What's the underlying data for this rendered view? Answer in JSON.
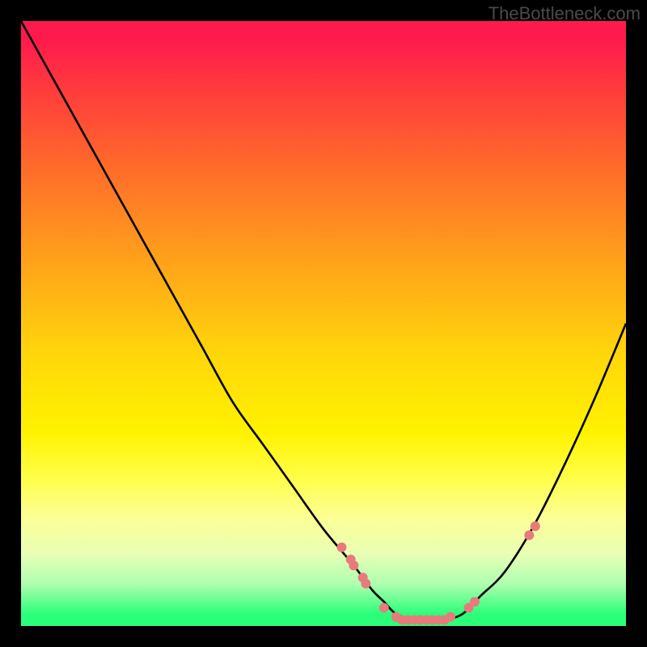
{
  "watermark": "TheBottleneck.com",
  "chart_data": {
    "type": "line",
    "title": "",
    "xlabel": "",
    "ylabel": "",
    "xlim": [
      0,
      100
    ],
    "ylim": [
      0,
      100
    ],
    "grid": false,
    "background_gradient": {
      "stops": [
        {
          "pos": 0,
          "color": "#ff1a4d"
        },
        {
          "pos": 11,
          "color": "#ff3a3d"
        },
        {
          "pos": 24,
          "color": "#ff6a2a"
        },
        {
          "pos": 40,
          "color": "#ffa31a"
        },
        {
          "pos": 55,
          "color": "#ffd60a"
        },
        {
          "pos": 68,
          "color": "#fff200"
        },
        {
          "pos": 82,
          "color": "#fcff94"
        },
        {
          "pos": 93,
          "color": "#b0ffb0"
        },
        {
          "pos": 100,
          "color": "#2bff7a"
        }
      ]
    },
    "series": [
      {
        "name": "bottleneck-curve",
        "color": "#000000",
        "x": [
          0,
          5,
          10,
          15,
          20,
          25,
          30,
          35,
          40,
          45,
          50,
          55,
          58,
          60,
          62,
          65,
          68,
          70,
          73,
          76,
          80,
          85,
          90,
          95,
          100
        ],
        "values": [
          100,
          91,
          82,
          73,
          64,
          55,
          46,
          37,
          30,
          23,
          16,
          10,
          6,
          4,
          2,
          1,
          1,
          1,
          2,
          5,
          9,
          17,
          27,
          38,
          50
        ]
      }
    ],
    "scatter": {
      "name": "highlighted-points",
      "color": "#e77b7b",
      "radius": 6,
      "points": [
        {
          "x": 53,
          "y": 13
        },
        {
          "x": 54.5,
          "y": 11
        },
        {
          "x": 55,
          "y": 10
        },
        {
          "x": 56.5,
          "y": 8
        },
        {
          "x": 57,
          "y": 7
        },
        {
          "x": 60,
          "y": 3
        },
        {
          "x": 62,
          "y": 1.5
        },
        {
          "x": 63,
          "y": 1
        },
        {
          "x": 64,
          "y": 1
        },
        {
          "x": 65,
          "y": 1
        },
        {
          "x": 66,
          "y": 1
        },
        {
          "x": 67,
          "y": 1
        },
        {
          "x": 68,
          "y": 1
        },
        {
          "x": 69,
          "y": 1
        },
        {
          "x": 70,
          "y": 1
        },
        {
          "x": 71,
          "y": 1.5
        },
        {
          "x": 74,
          "y": 3
        },
        {
          "x": 75,
          "y": 4
        },
        {
          "x": 84,
          "y": 15
        },
        {
          "x": 85,
          "y": 16.5
        }
      ]
    }
  }
}
